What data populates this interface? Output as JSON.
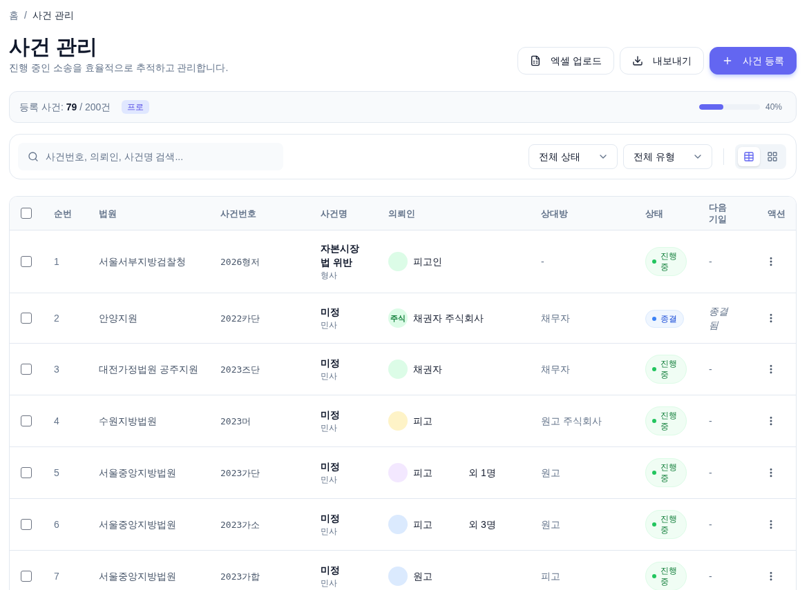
{
  "breadcrumb": {
    "items": [
      {
        "label": "홈"
      },
      {
        "label": "사건 관리"
      }
    ],
    "separator": "/"
  },
  "header": {
    "title": "사건 관리",
    "subtitle": "진행 중인 소송을 효율적으로 추적하고 관리합니다."
  },
  "actions": [
    {
      "label": "엑셀 업로드",
      "kind": "upload"
    },
    {
      "label": "내보내기",
      "kind": "export"
    },
    {
      "label": "사건 등록",
      "kind": "primary"
    }
  ],
  "usage": {
    "text": "등록 사건: **79** / 200건",
    "plan": "프로",
    "level": 0.4,
    "reading": "40%"
  },
  "filters": {
    "search": {
      "placeholder": "사건번호, 의뢰인, 사건명 검색..."
    },
    "selects": [
      {
        "value": "전체 상태"
      },
      {
        "value": "전체 유형"
      }
    ],
    "views": [
      {
        "kind": "table",
        "selected": true
      },
      {
        "kind": "grid",
        "selected": false
      }
    ]
  },
  "table": {
    "select_all": {
      "checked": false
    },
    "columns": [
      "순번",
      "법원",
      "사건번호",
      "사건명",
      "의뢰인",
      "상대방",
      "상태",
      "다음 기일",
      "액션"
    ],
    "rows": [
      {
        "checked": false,
        "no": "1",
        "court": "서울서부지방검찰청",
        "case_no": "2026형저",
        "case_name": "자본시장법 위반",
        "case_type": "형사",
        "client": {
          "name": "피고인",
          "color": "#dcfce7"
        },
        "opponent": "-",
        "status": {
          "label": "진행 중",
          "kind": "active"
        },
        "next_hearing": {
          "text": "-",
          "kind": "none"
        }
      },
      {
        "checked": false,
        "no": "2",
        "court": "안양지원",
        "case_no": "2022카단",
        "case_name": "미정",
        "case_type": "민사",
        "client": {
          "name": "채권자 주식회사",
          "initials": "주식",
          "color": "#dcfce7"
        },
        "opponent": "채무자",
        "status": {
          "label": "종결",
          "kind": "closed"
        },
        "next_hearing": {
          "text": "종결됨",
          "kind": "closed"
        }
      },
      {
        "checked": false,
        "no": "3",
        "court": "대전가정법원 공주지원",
        "case_no": "2023즈단",
        "case_name": "미정",
        "case_type": "민사",
        "client": {
          "name": "채권자",
          "color": "#dcfce7"
        },
        "opponent": "채무자",
        "status": {
          "label": "진행 중",
          "kind": "active"
        },
        "next_hearing": {
          "text": "-",
          "kind": "none"
        }
      },
      {
        "checked": false,
        "no": "4",
        "court": "수원지방법원",
        "case_no": "2023머",
        "case_name": "미정",
        "case_type": "민사",
        "client": {
          "name": "피고",
          "color": "#fef3c7"
        },
        "opponent": "원고 주식회사",
        "status": {
          "label": "진행 중",
          "kind": "active"
        },
        "next_hearing": {
          "text": "-",
          "kind": "none"
        }
      },
      {
        "checked": false,
        "no": "5",
        "court": "서울중앙지방법원",
        "case_no": "2023가단",
        "case_name": "미정",
        "case_type": "민사",
        "client": {
          "name": "피고",
          "extra": "외 1명",
          "color": "#f3e8ff"
        },
        "opponent": "원고",
        "status": {
          "label": "진행 중",
          "kind": "active"
        },
        "next_hearing": {
          "text": "-",
          "kind": "none"
        }
      },
      {
        "checked": false,
        "no": "6",
        "court": "서울중앙지방법원",
        "case_no": "2023가소",
        "case_name": "미정",
        "case_type": "민사",
        "client": {
          "name": "피고",
          "extra": "외 3명",
          "color": "#dbeafe"
        },
        "opponent": "원고",
        "status": {
          "label": "진행 중",
          "kind": "active"
        },
        "next_hearing": {
          "text": "-",
          "kind": "none"
        }
      },
      {
        "checked": false,
        "no": "7",
        "court": "서울중앙지방법원",
        "case_no": "2023가합",
        "case_name": "미정",
        "case_type": "민사",
        "client": {
          "name": "원고",
          "color": "#dbeafe"
        },
        "opponent": "피고",
        "status": {
          "label": "진행 중",
          "kind": "active"
        },
        "next_hearing": {
          "text": "-",
          "kind": "none"
        }
      }
    ]
  }
}
